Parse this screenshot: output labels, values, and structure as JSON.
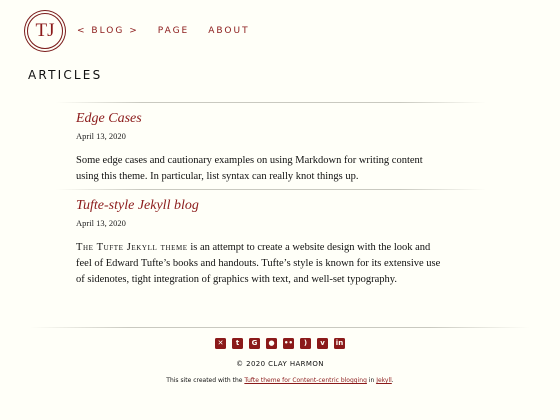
{
  "logo": {
    "text": "TJ"
  },
  "nav": {
    "blog": "< BLOG >",
    "page": "PAGE",
    "about": "ABOUT"
  },
  "page_title": "ARTICLES",
  "articles": [
    {
      "title": "Edge Cases",
      "date": "April 13, 2020",
      "summary": "Some edge cases and cautionary examples on using Markdown for writing content using this theme. In particular, list syntax can really knot things up."
    },
    {
      "title": "Tufte-style Jekyll blog",
      "date": "April 13, 2020",
      "summary_lead": "The Tufte Jekyll theme",
      "summary_rest": " is an attempt to create a website design with the look and feel of Edward Tufte’s books and handouts. Tufte’s style is known for its extensive use of sidenotes, tight integration of graphics with text, and well-set typography."
    }
  ],
  "social_icons": [
    "email",
    "twitter",
    "google-plus",
    "github",
    "flickr",
    "rss",
    "vimeo",
    "linkedin"
  ],
  "footer": {
    "copyright": "© 2020   CLAY HARMON",
    "credits_prefix": "This site created with the ",
    "credits_link1": "Tufte theme for Content-centric blogging",
    "credits_middle": " in ",
    "credits_link2": "Jekyll",
    "credits_suffix": "."
  },
  "colors": {
    "accent": "#8b1a1a",
    "background": "#fffff8",
    "text": "#111111"
  }
}
